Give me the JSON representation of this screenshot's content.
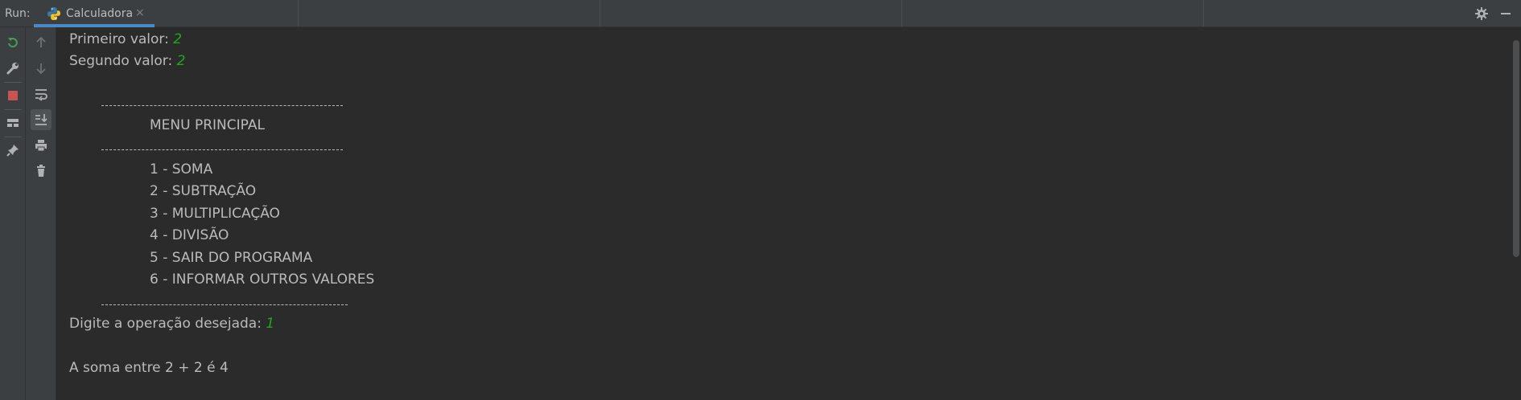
{
  "header": {
    "run_label": "Run:",
    "tab_title": "Calculadora",
    "close_glyph": "×"
  },
  "toolbar": {
    "left_icons": [
      "rerun-icon",
      "wrench-icon",
      "stop-icon",
      "layout-icon",
      "pin-icon"
    ],
    "right_icons": [
      "up-arrow-icon",
      "down-arrow-icon",
      "soft-wrap-icon",
      "scroll-to-end-icon",
      "print-icon",
      "trash-icon"
    ],
    "right_controls": [
      "gear-icon",
      "minimize-icon"
    ]
  },
  "console": {
    "first_prompt": "Primeiro valor: ",
    "first_input": "2",
    "second_prompt": "Segundo valor: ",
    "second_input": "2",
    "menu_title": "MENU PRINCIPAL",
    "menu_items": [
      "1 - SOMA",
      "2 - SUBTRAÇÃO",
      "3 - MULTIPLICAÇÃO",
      "4 - DIVISÃO",
      "5 - SAIR DO PROGRAMA",
      "6 - INFORMAR OUTROS VALORES"
    ],
    "operation_prompt": "Digite a operação desejada: ",
    "operation_input": "1",
    "result": "A soma entre 2 + 2 é 4"
  },
  "colors": {
    "background": "#2b2b2b",
    "panel": "#3c3f41",
    "text": "#bbbbbb",
    "input": "#1ea81e",
    "accent": "#4a88c7"
  }
}
